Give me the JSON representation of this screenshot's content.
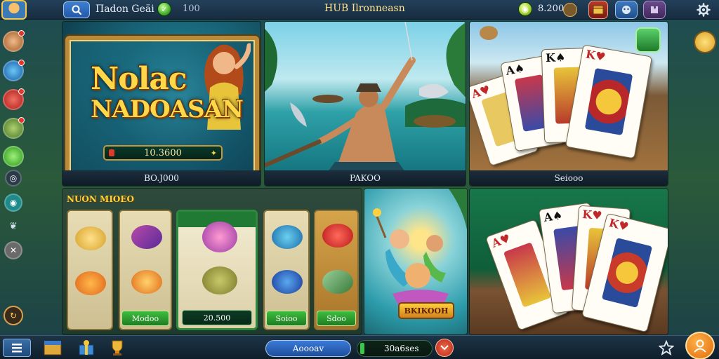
{
  "header": {
    "profile_name": "Пadon Geäi",
    "gem_count": "100",
    "title": "HUB Ilronneasn",
    "coin_balance": "8.200"
  },
  "tiles": [
    {
      "caption": "BO.J000",
      "game_title_line1": "Nolac",
      "game_title_line2": "NADOASAN",
      "balance": "10.3600"
    },
    {
      "caption": "PAKOO"
    },
    {
      "caption": "Seiooo"
    },
    {
      "header": "NUON MIOEO",
      "reel_buttons": [
        "Modoo",
        "20.500",
        "Soioo",
        "Sdoo"
      ]
    },
    {
      "promo_label": "BKIKOOH"
    },
    {}
  ],
  "footer": {
    "primary_button": "Aoooav",
    "balance": "30a6ses"
  },
  "colors": {
    "accent_gold": "#ffd84a",
    "topbar_bg": "#172c40",
    "green_button": "#1e7c21",
    "close_red": "#e5352a"
  },
  "icons": {
    "top": [
      "avatar",
      "search-icon",
      "gem-icon",
      "coin-icon",
      "trophy-icon",
      "chest-icon",
      "chat-icon",
      "puzzle-icon",
      "settings-gear-icon"
    ],
    "side": [
      "avatar-1",
      "avatar-2",
      "avatar-3",
      "avatar-4",
      "green-gem",
      "spiral-icon",
      "eye-icon",
      "leaf-icon",
      "clock-icon",
      "share-icon"
    ],
    "bottom": [
      "menu-icon",
      "shop-icon",
      "gift-icon",
      "trophy-icon",
      "close-icon",
      "star-icon",
      "profile-icon"
    ]
  }
}
